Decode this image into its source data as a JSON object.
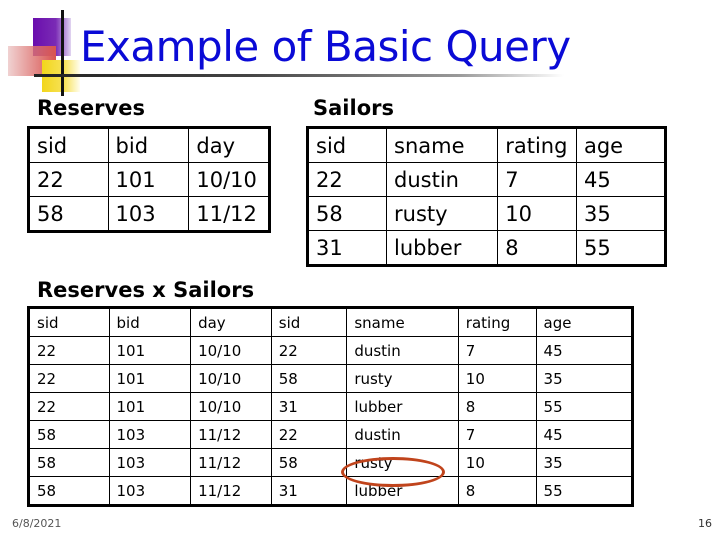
{
  "title": "Example of Basic Query",
  "reserves": {
    "label": "Reserves",
    "columns": [
      "sid",
      "bid",
      "day"
    ],
    "rows": [
      [
        "22",
        "101",
        "10/10"
      ],
      [
        "58",
        "103",
        "11/12"
      ]
    ]
  },
  "sailors": {
    "label": "Sailors",
    "columns": [
      "sid",
      "sname",
      "rating",
      "age"
    ],
    "rows": [
      [
        "22",
        "dustin",
        "7",
        "45"
      ],
      [
        "58",
        "rusty",
        "10",
        "35"
      ],
      [
        "31",
        "lubber",
        "8",
        "55"
      ]
    ]
  },
  "cross_product": {
    "label": "Reserves x Sailors",
    "columns": [
      "sid",
      "bid",
      "day",
      "sid",
      "sname",
      "rating",
      "age"
    ],
    "rows": [
      [
        "22",
        "101",
        "10/10",
        "22",
        "dustin",
        "7",
        "45"
      ],
      [
        "22",
        "101",
        "10/10",
        "58",
        "rusty",
        "10",
        "35"
      ],
      [
        "22",
        "101",
        "10/10",
        "31",
        "lubber",
        "8",
        "55"
      ],
      [
        "58",
        "103",
        "11/12",
        "22",
        "dustin",
        "7",
        "45"
      ],
      [
        "58",
        "103",
        "11/12",
        "58",
        "rusty",
        "10",
        "35"
      ],
      [
        "58",
        "103",
        "11/12",
        "31",
        "lubber",
        "8",
        "55"
      ]
    ],
    "highlighted_cell": "rusty"
  },
  "footer": {
    "date": "6/8/2021",
    "page_number": "16"
  },
  "colors": {
    "title": "#0a0ad6",
    "highlight_ellipse": "#c0441c"
  }
}
